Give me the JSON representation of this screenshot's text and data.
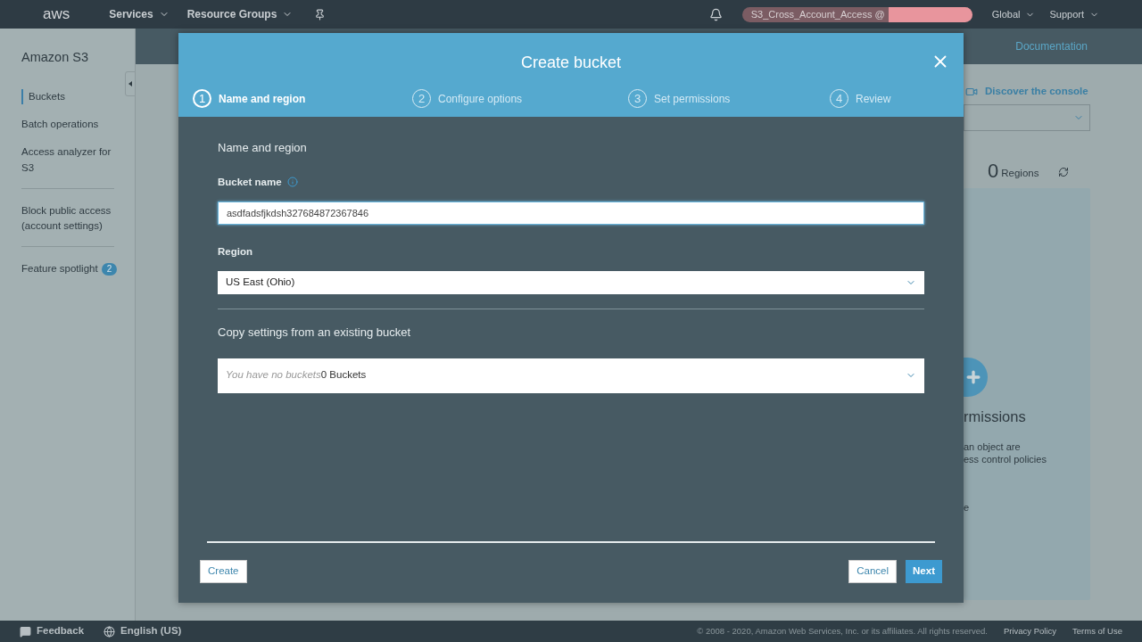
{
  "top_nav": {
    "logo": "aws",
    "menus": [
      {
        "label": "Services"
      },
      {
        "label": "Resource Groups"
      }
    ],
    "account": "S3_Cross_Account_Access @",
    "region": "Global",
    "support": "Support"
  },
  "sidebar": {
    "title": "Amazon S3",
    "groups": [
      [
        {
          "label": "Buckets",
          "selected": true
        },
        {
          "label": "Batch operations",
          "selected": false
        },
        {
          "label": "Access analyzer for S3",
          "selected": false
        }
      ],
      [
        {
          "label": "Block public access (account settings)",
          "selected": false
        }
      ],
      [
        {
          "label": "Feature spotlight",
          "selected": false,
          "badge": "2"
        }
      ]
    ]
  },
  "background": {
    "documentation": "Documentation",
    "discover": "Discover the console",
    "region_count": "0",
    "regions_label": "Regions",
    "card_title": "rmissions",
    "card_lines": [
      "an object are",
      "ess control policies"
    ],
    "card_link": "e"
  },
  "modal": {
    "title": "Create bucket",
    "steps": [
      {
        "number": "1",
        "label": "Name and region",
        "selected": true
      },
      {
        "number": "2",
        "label": "Configure options",
        "selected": false
      },
      {
        "number": "3",
        "label": "Set permissions",
        "selected": false
      },
      {
        "number": "4",
        "label": "Review",
        "selected": false
      }
    ],
    "section_title": "Name and region",
    "bucket_name": {
      "label": "Bucket name",
      "value": "asdfadsfjkdsh327684872367846"
    },
    "region": {
      "label": "Region",
      "value": "US East (Ohio)"
    },
    "copy": {
      "title": "Copy settings from an existing bucket",
      "placeholder": "You have no buckets",
      "count": "0 Buckets"
    },
    "buttons": {
      "create": "Create",
      "cancel": "Cancel",
      "next": "Next"
    }
  },
  "footer": {
    "feedback": "Feedback",
    "language": "English (US)",
    "copyright": "© 2008 - 2020, Amazon Web Services, Inc. or its affiliates. All rights reserved.",
    "links": [
      "Privacy Policy",
      "Terms of Use"
    ]
  }
}
